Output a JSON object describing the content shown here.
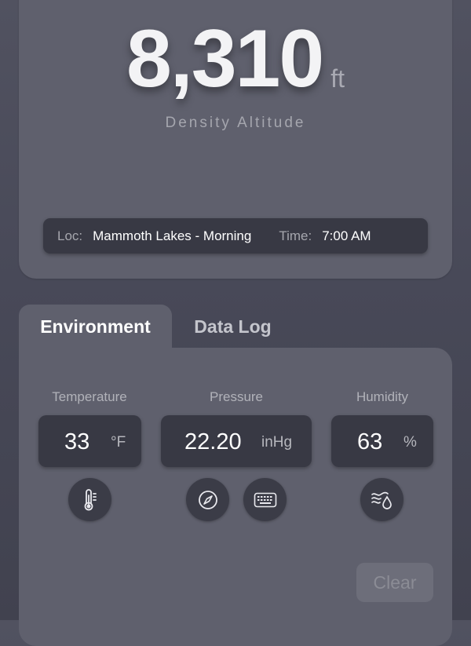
{
  "result": {
    "altitude": "8,310",
    "unit": "ft",
    "caption": "Density Altitude"
  },
  "info": {
    "loc_label": "Loc:",
    "loc_value": "Mammoth Lakes - Morning",
    "time_label": "Time:",
    "time_value": "7:00 AM"
  },
  "tabs": [
    {
      "label": "Environment",
      "selected": true
    },
    {
      "label": "Data Log",
      "selected": false
    }
  ],
  "environment": {
    "temperature": {
      "label": "Temperature",
      "value": "33",
      "unit": "°F",
      "icon": "thermometer-icon"
    },
    "pressure": {
      "label": "Pressure",
      "value": "22.20",
      "unit": "inHg",
      "icons": [
        "compass-icon",
        "keyboard-icon"
      ]
    },
    "humidity": {
      "label": "Humidity",
      "value": "63",
      "unit": "%",
      "icon": "humidity-icon"
    }
  },
  "actions": {
    "clear_label": "Clear"
  },
  "colors": {
    "background": "#484958",
    "card": "#5f606d",
    "field": "#383944",
    "clear_button": "#6d6e7a"
  }
}
